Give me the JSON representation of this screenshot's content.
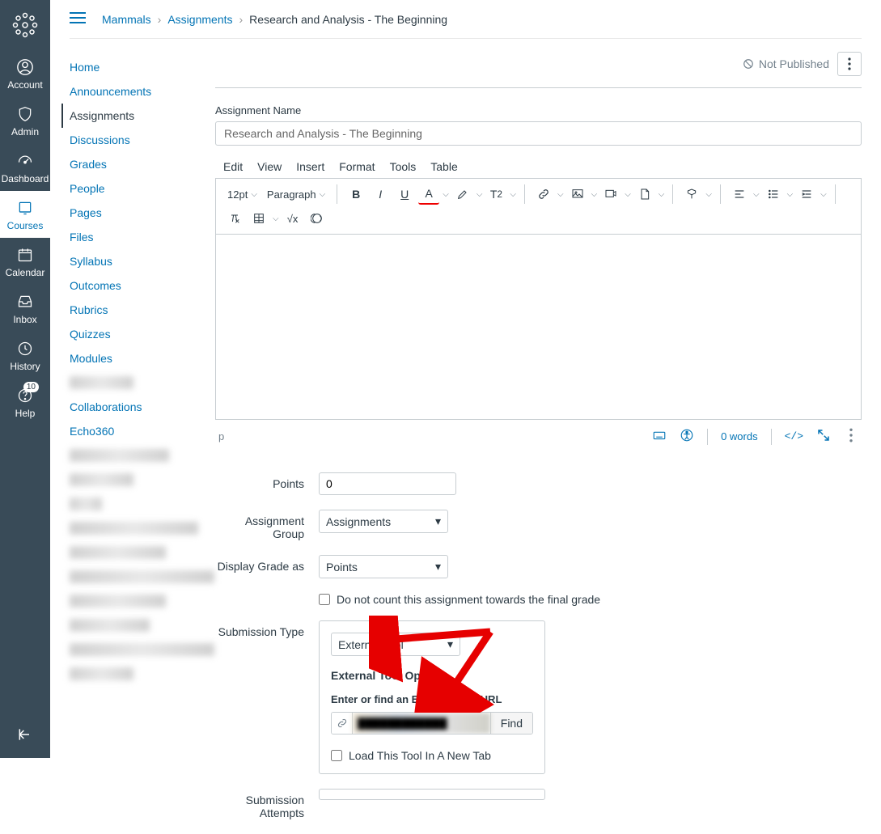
{
  "global_nav": {
    "items": [
      {
        "label": "Account",
        "icon": "user"
      },
      {
        "label": "Admin",
        "icon": "shield"
      },
      {
        "label": "Dashboard",
        "icon": "speedometer"
      },
      {
        "label": "Courses",
        "icon": "book",
        "active": true
      },
      {
        "label": "Calendar",
        "icon": "calendar"
      },
      {
        "label": "Inbox",
        "icon": "inbox"
      },
      {
        "label": "History",
        "icon": "clock"
      },
      {
        "label": "Help",
        "icon": "help",
        "badge": "10"
      }
    ]
  },
  "breadcrumb": {
    "items": [
      "Mammals",
      "Assignments"
    ],
    "current": "Research and Analysis - The Beginning"
  },
  "course_nav": {
    "items": [
      {
        "label": "Home"
      },
      {
        "label": "Announcements"
      },
      {
        "label": "Assignments",
        "active": true
      },
      {
        "label": "Discussions"
      },
      {
        "label": "Grades"
      },
      {
        "label": "People"
      },
      {
        "label": "Pages"
      },
      {
        "label": "Files"
      },
      {
        "label": "Syllabus"
      },
      {
        "label": "Outcomes"
      },
      {
        "label": "Rubrics"
      },
      {
        "label": "Quizzes"
      },
      {
        "label": "Modules"
      },
      {
        "label": "████████",
        "redacted": true
      },
      {
        "label": "Collaborations"
      },
      {
        "label": "Echo360"
      },
      {
        "label": "████████  ████",
        "redacted": true
      },
      {
        "label": "████████",
        "redacted": true
      },
      {
        "label": "████",
        "redacted": true
      },
      {
        "label": "████████████████",
        "redacted": true
      },
      {
        "label": "████████████",
        "redacted": true
      },
      {
        "label": "██████████████████",
        "redacted": true
      },
      {
        "label": "████████████",
        "redacted": true
      },
      {
        "label": "██████████",
        "redacted": true
      },
      {
        "label": "██████████████████",
        "redacted": true
      },
      {
        "label": "████████",
        "redacted": true
      }
    ]
  },
  "header": {
    "status": "Not Published"
  },
  "form": {
    "name_label": "Assignment Name",
    "name_value": "Research and Analysis - The Beginning",
    "rce_menu": [
      "Edit",
      "View",
      "Insert",
      "Format",
      "Tools",
      "Table"
    ],
    "font_size": "12pt",
    "font_style": "Paragraph",
    "path": "p",
    "word_count": "0 words",
    "points_label": "Points",
    "points_value": "0",
    "group_label": "Assignment Group",
    "group_value": "Assignments",
    "display_label": "Display Grade as",
    "display_value": "Points",
    "no_count_label": "Do not count this assignment towards the final grade",
    "submission_label": "Submission Type",
    "submission_value": "External Tool",
    "ext_options_heading": "External Tool Options",
    "ext_url_heading": "Enter or find an External Tool URL",
    "find_button": "Find",
    "load_new_tab_label": "Load This Tool In A New Tab",
    "attempts_label": "Submission Attempts"
  }
}
